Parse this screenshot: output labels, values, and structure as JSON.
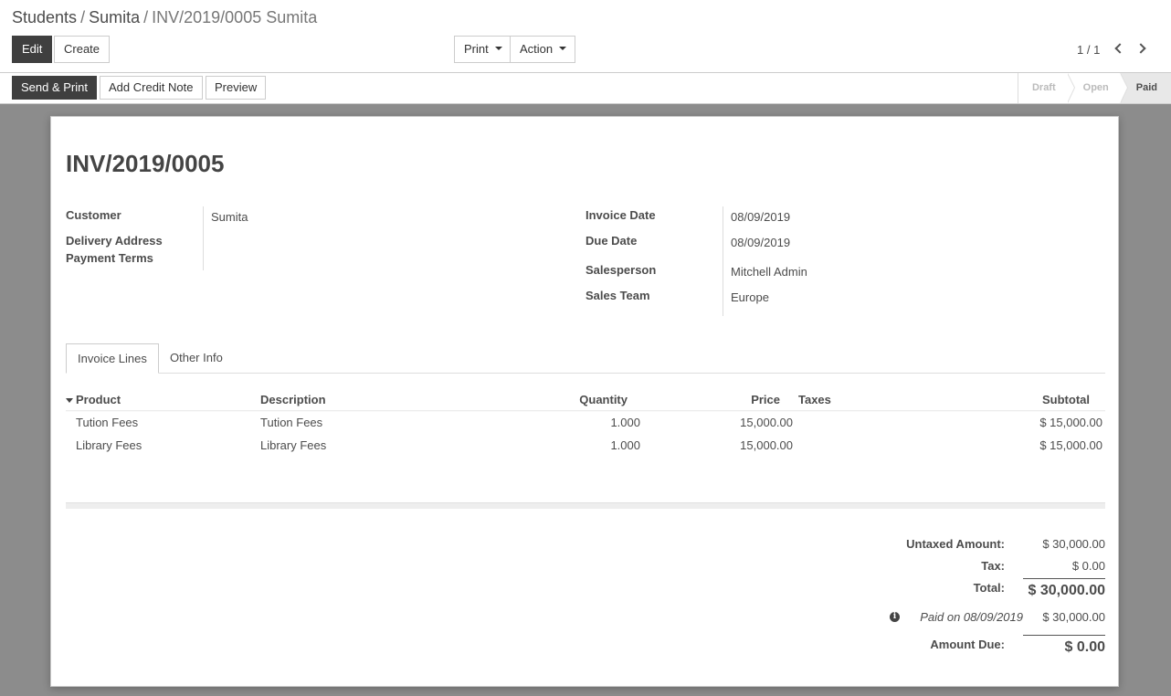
{
  "breadcrumb": {
    "items": [
      "Students",
      "Sumita"
    ],
    "current": "INV/2019/0005 Sumita",
    "separator": "/"
  },
  "buttons": {
    "edit": "Edit",
    "create": "Create",
    "print": "Print",
    "action": "Action"
  },
  "pager": {
    "value": "1 / 1"
  },
  "statusbar": {
    "send_print": "Send & Print",
    "add_credit_note": "Add Credit Note",
    "preview": "Preview",
    "stages": [
      "Draft",
      "Open",
      "Paid"
    ],
    "active_stage": "Paid"
  },
  "invoice": {
    "number": "INV/2019/0005",
    "left_fields": {
      "customer_label": "Customer",
      "customer_value": "Sumita",
      "delivery_label": "Delivery Address",
      "payment_terms_label": "Payment Terms"
    },
    "right_fields": {
      "invoice_date_label": "Invoice Date",
      "invoice_date_value": "08/09/2019",
      "due_date_label": "Due Date",
      "due_date_value": "08/09/2019",
      "salesperson_label": "Salesperson",
      "salesperson_value": "Mitchell Admin",
      "sales_team_label": "Sales Team",
      "sales_team_value": "Europe"
    }
  },
  "tabs": {
    "invoice_lines": "Invoice Lines",
    "other_info": "Other Info"
  },
  "table": {
    "headers": {
      "product": "Product",
      "description": "Description",
      "quantity": "Quantity",
      "price": "Price",
      "taxes": "Taxes",
      "subtotal": "Subtotal"
    },
    "rows": [
      {
        "product": "Tution Fees",
        "description": "Tution Fees",
        "quantity": "1.000",
        "price": "15,000.00",
        "taxes": "",
        "subtotal": "$ 15,000.00"
      },
      {
        "product": "Library Fees",
        "description": "Library Fees",
        "quantity": "1.000",
        "price": "15,000.00",
        "taxes": "",
        "subtotal": "$ 15,000.00"
      }
    ]
  },
  "totals": {
    "untaxed_label": "Untaxed Amount:",
    "untaxed_value": "$ 30,000.00",
    "tax_label": "Tax:",
    "tax_value": "$ 0.00",
    "total_label": "Total:",
    "total_value": "$ 30,000.00",
    "paid_label": "Paid on 08/09/2019",
    "paid_value": "$ 30,000.00",
    "amount_due_label": "Amount Due:",
    "amount_due_value": "$ 0.00"
  },
  "icons": {
    "info": "info-icon",
    "pager_prev": "chevron-left-icon",
    "pager_next": "chevron-right-icon",
    "dropdown": "caret-down-icon",
    "sort": "sort-caret-icon"
  }
}
